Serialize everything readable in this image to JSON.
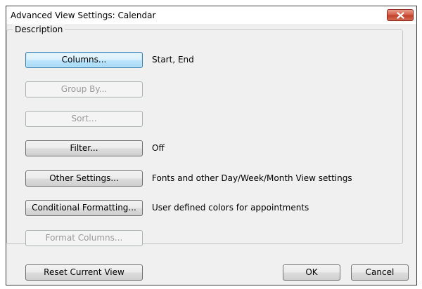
{
  "window": {
    "title": "Advanced View Settings: Calendar"
  },
  "group": {
    "label": "Description"
  },
  "rows": [
    {
      "button": "Columns...",
      "description": "Start, End",
      "enabled": true
    },
    {
      "button": "Group By...",
      "description": "",
      "enabled": false
    },
    {
      "button": "Sort...",
      "description": "",
      "enabled": false
    },
    {
      "button": "Filter...",
      "description": "Off",
      "enabled": true
    },
    {
      "button": "Other Settings...",
      "description": "Fonts and other Day/Week/Month View settings",
      "enabled": true
    },
    {
      "button": "Conditional Formatting...",
      "description": "User defined colors for appointments",
      "enabled": true
    },
    {
      "button": "Format Columns...",
      "description": "",
      "enabled": false
    }
  ],
  "footer": {
    "reset_label": "Reset Current View",
    "ok_label": "OK",
    "cancel_label": "Cancel"
  },
  "icons": {
    "close": "close-icon"
  }
}
